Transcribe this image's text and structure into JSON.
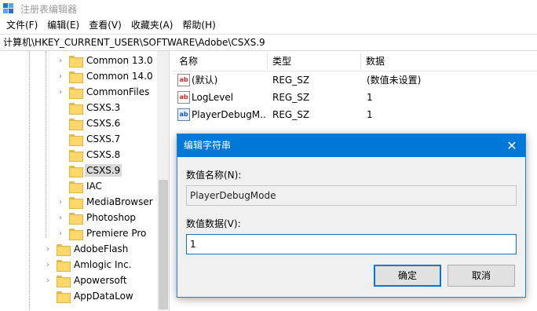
{
  "window": {
    "title": "注册表编辑器",
    "app_icon": "registry-editor-icon"
  },
  "menu": [
    {
      "label": "文件(F)"
    },
    {
      "label": "编辑(E)"
    },
    {
      "label": "查看(V)"
    },
    {
      "label": "收藏夹(A)"
    },
    {
      "label": "帮助(H)"
    }
  ],
  "address": {
    "path": "计算机\\HKEY_CURRENT_USER\\SOFTWARE\\Adobe\\CSXS.9"
  },
  "tree": {
    "items": [
      {
        "label": "Common 13.0",
        "level": 3,
        "selected": false
      },
      {
        "label": "Common 14.0",
        "level": 3,
        "selected": false
      },
      {
        "label": "CommonFiles",
        "level": 3,
        "selected": false
      },
      {
        "label": "CSXS.3",
        "level": 3,
        "selected": false
      },
      {
        "label": "CSXS.6",
        "level": 3,
        "selected": false
      },
      {
        "label": "CSXS.7",
        "level": 3,
        "selected": false
      },
      {
        "label": "CSXS.8",
        "level": 3,
        "selected": false
      },
      {
        "label": "CSXS.9",
        "level": 3,
        "selected": true
      },
      {
        "label": "IAC",
        "level": 3,
        "selected": false
      },
      {
        "label": "MediaBrowser",
        "level": 3,
        "selected": false
      },
      {
        "label": "Photoshop",
        "level": 3,
        "selected": false
      },
      {
        "label": "Premiere Pro",
        "level": 3,
        "selected": false
      },
      {
        "label": "AdobeFlash",
        "level": 2,
        "selected": false
      },
      {
        "label": "Amlogic Inc.",
        "level": 2,
        "selected": false
      },
      {
        "label": "Apowersoft",
        "level": 2,
        "selected": false
      },
      {
        "label": "AppDataLow",
        "level": 2,
        "selected": false
      }
    ]
  },
  "values": {
    "headers": {
      "name": "名称",
      "type": "类型",
      "data": "数据"
    },
    "rows": [
      {
        "icon": "string-value-icon",
        "name": "(默认)",
        "type": "REG_SZ",
        "data": "(数值未设置)"
      },
      {
        "icon": "string-value-icon",
        "name": "LogLevel",
        "type": "REG_SZ",
        "data": "1"
      },
      {
        "icon": "string-value-icon",
        "name": "PlayerDebugM...",
        "type": "REG_SZ",
        "data": "1"
      }
    ]
  },
  "dialog": {
    "title": "编辑字符串",
    "name_label": "数值名称(N):",
    "name_value": "PlayerDebugMode",
    "data_label": "数值数据(V):",
    "data_value": "1",
    "ok_label": "确定",
    "cancel_label": "取消"
  },
  "colors": {
    "accent": "#0078d7",
    "selection": "#d9d9d9",
    "folder": "#ffd76a"
  }
}
